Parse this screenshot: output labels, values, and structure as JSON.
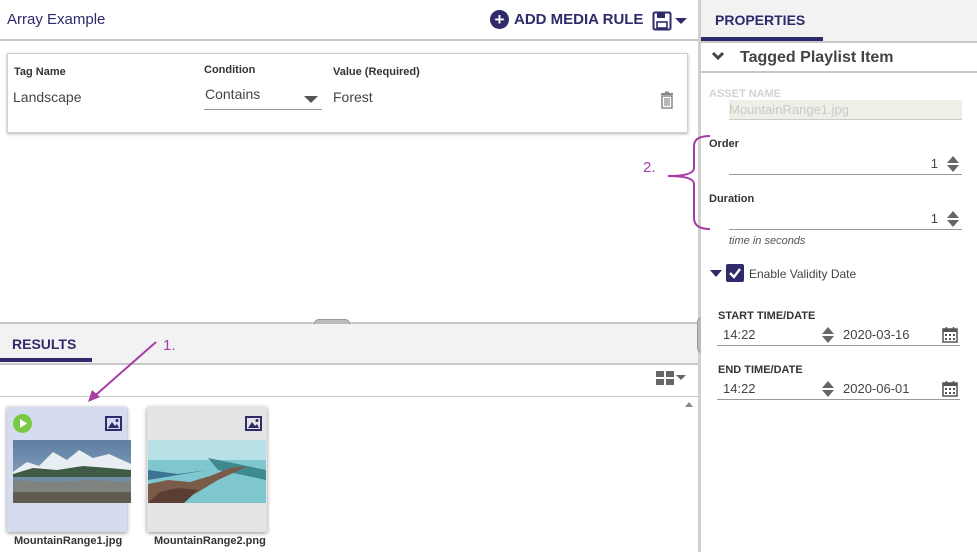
{
  "editor": {
    "title": "Array Example",
    "add_rule_label": "ADD MEDIA RULE"
  },
  "rule": {
    "tag_label": "Tag Name",
    "tag_value": "Landscape",
    "condition_label": "Condition",
    "condition_value": "Contains",
    "value_label": "Value (Required)",
    "value_value": "Forest"
  },
  "results": {
    "tab_label": "RESULTS",
    "items": [
      {
        "name": "MountainRange1.jpg",
        "selected": true,
        "playing": true
      },
      {
        "name": "MountainRange2.png",
        "selected": false,
        "playing": false
      }
    ]
  },
  "properties": {
    "tab_label": "PROPERTIES",
    "section_title": "Tagged Playlist Item",
    "asset_label": "ASSET NAME",
    "asset_value": "MountainRange1.jpg",
    "order_label": "Order",
    "order_value": "1",
    "duration_label": "Duration",
    "duration_value": "1",
    "duration_hint": "time in seconds",
    "validity_label": "Enable Validity Date",
    "validity_checked": true,
    "start_label": "START TIME/DATE",
    "start_time": "14:22",
    "start_date": "2020-03-16",
    "end_label": "END TIME/DATE",
    "end_time": "14:22",
    "end_date": "2020-06-01"
  },
  "annotations": {
    "callout_1": "1.",
    "callout_2": "2."
  },
  "colors": {
    "brand": "#2e2a6b",
    "callout": "#a63da6",
    "play": "#7ac943",
    "selected_bg": "#d6dcef"
  }
}
